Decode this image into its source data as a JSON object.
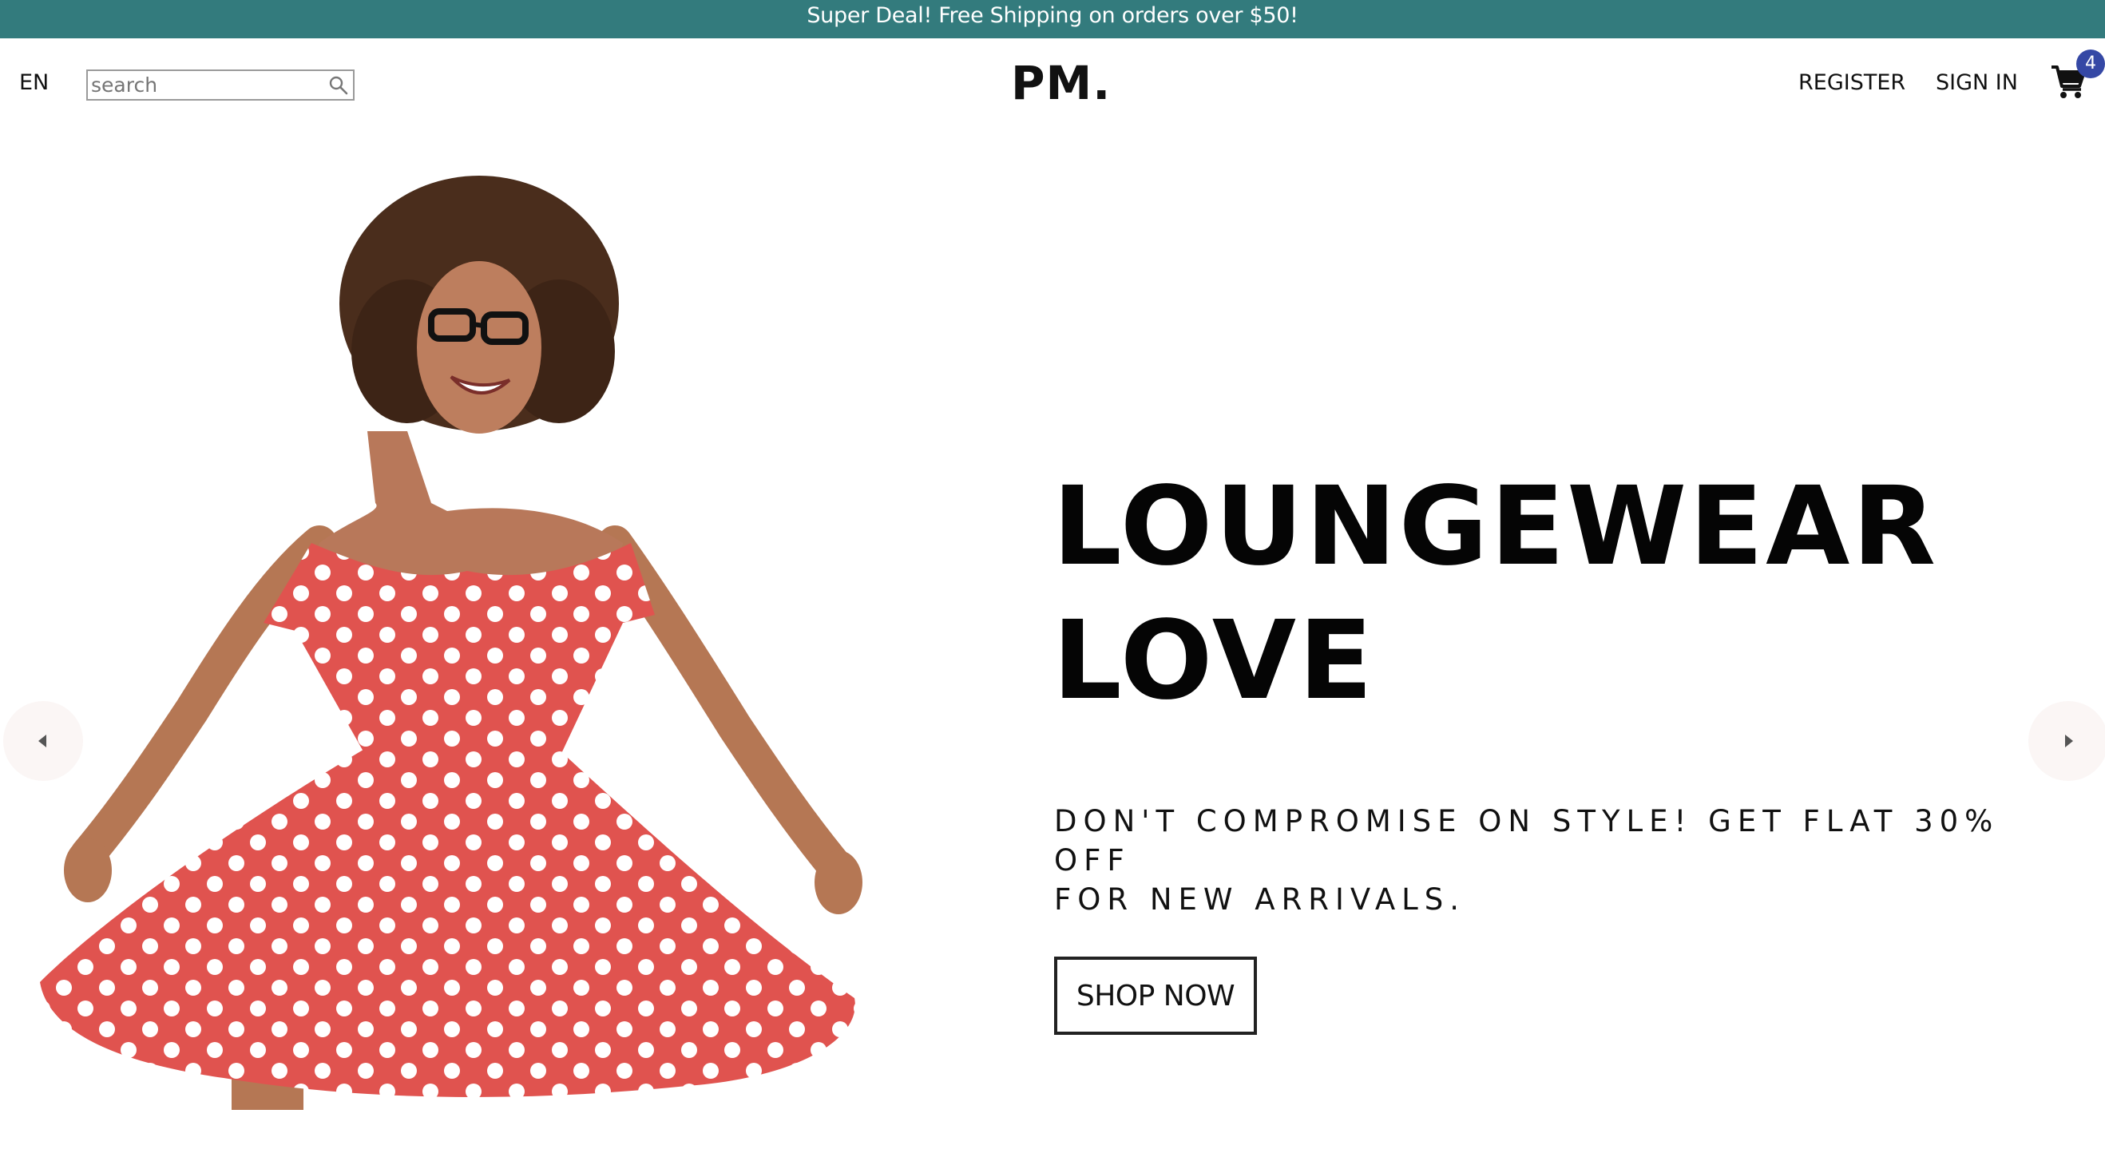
{
  "announcement": {
    "text": "Super Deal! Free Shipping on orders over $50!"
  },
  "header": {
    "language": "EN",
    "search": {
      "placeholder": "search",
      "value": ""
    },
    "logo": "PM.",
    "nav": {
      "register": "REGISTER",
      "sign_in": "SIGN IN"
    },
    "cart": {
      "count": "4",
      "icon": "cart-icon"
    }
  },
  "hero": {
    "title_line1": "LOUNGEWEAR",
    "title_line2": "LOVE",
    "subtitle_line1": "DON'T COMPROMISE ON STYLE! GET FLAT 30% OFF",
    "subtitle_line2": "FOR NEW ARRIVALS.",
    "cta_label": "SHOP NOW",
    "image": "woman-red-polka-dot-dress-photo"
  },
  "colors": {
    "announcement_bg": "#337b7d",
    "badge_bg": "#3548a5",
    "dress": "#e0534f"
  }
}
